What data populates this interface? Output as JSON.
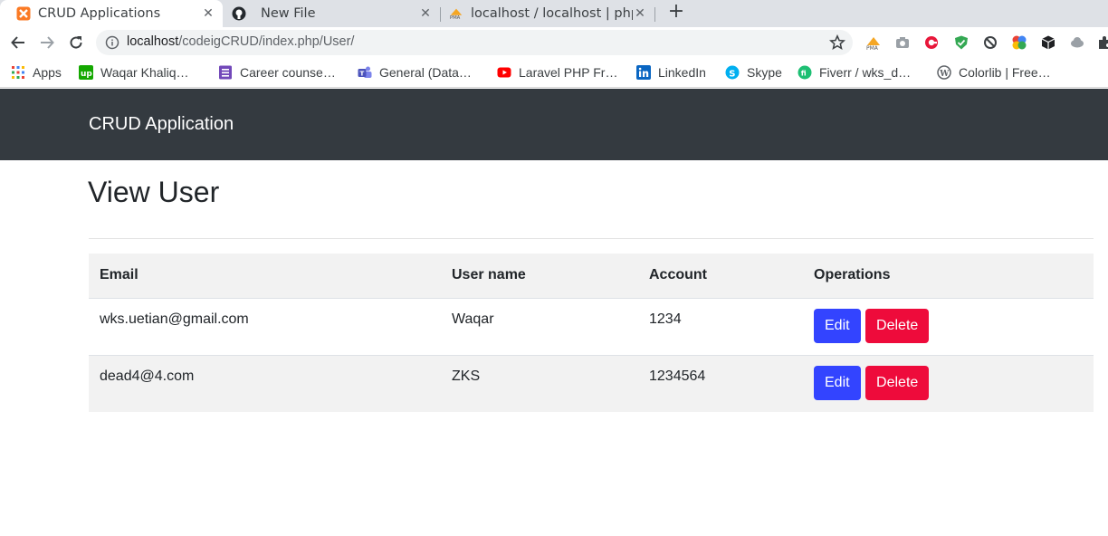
{
  "browser": {
    "tabs": [
      {
        "title": "CRUD Applications",
        "active": true,
        "favicon": "xampp-icon"
      },
      {
        "title": "New File",
        "active": false,
        "favicon": "github-icon"
      },
      {
        "title": "localhost / localhost | php",
        "active": false,
        "favicon": "phpmyadmin-icon"
      }
    ],
    "address_bar": {
      "host": "localhost",
      "path": "/codeigCRUD/index.php/User/"
    },
    "bookmarks": [
      {
        "label": "Apps",
        "icon": "apps-grid-icon"
      },
      {
        "label": "Waqar Khaliq…",
        "icon": "upwork-icon"
      },
      {
        "label": "Career counse…",
        "icon": "forms-icon"
      },
      {
        "label": "General (Data…",
        "icon": "teams-icon"
      },
      {
        "label": "Laravel PHP Fr…",
        "icon": "youtube-icon"
      },
      {
        "label": "LinkedIn",
        "icon": "linkedin-icon"
      },
      {
        "label": "Skype",
        "icon": "skype-icon"
      },
      {
        "label": "Fiverr / wks_d…",
        "icon": "fiverr-icon"
      },
      {
        "label": "Colorlib | Free…",
        "icon": "wordpress-icon"
      }
    ]
  },
  "navbar": {
    "brand": "CRUD Application"
  },
  "page": {
    "title": "View User"
  },
  "users_table": {
    "headers": [
      "Email",
      "User name",
      "Account",
      "Operations"
    ],
    "rows": [
      {
        "email": "wks.uetian@gmail.com",
        "username": "Waqar",
        "account": "1234"
      },
      {
        "email": "dead4@4.com",
        "username": "ZKS",
        "account": "1234564"
      }
    ],
    "edit_label": "Edit",
    "delete_label": "Delete"
  },
  "colors": {
    "navbar_bg": "#343a40",
    "edit_button": "#3344ff",
    "delete_button": "#ee0b3b"
  }
}
